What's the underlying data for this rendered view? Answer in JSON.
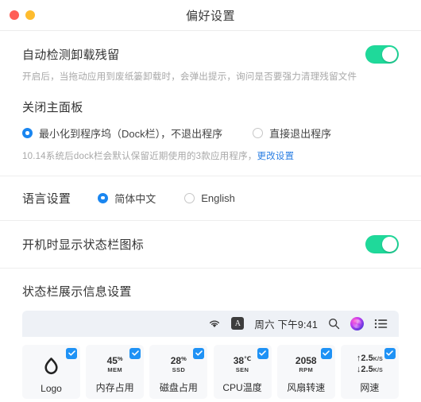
{
  "window": {
    "title": "偏好设置",
    "controls": [
      {
        "name": "close-button",
        "color": "#ff5f57"
      },
      {
        "name": "minimize-button",
        "color": "#febc2e"
      }
    ]
  },
  "sections": {
    "auto_detect": {
      "heading": "自动检测卸载残留",
      "description": "开启后，当拖动应用到废纸篓卸载时，会弹出提示，询问是否要强力清理残留文件",
      "toggle_on": true
    },
    "close_panel": {
      "heading": "关闭主面板",
      "options": [
        {
          "label": "最小化到程序坞（Dock栏），不退出程序",
          "selected": true
        },
        {
          "label": "直接退出程序",
          "selected": false
        }
      ],
      "note_text": "10.14系统后dock栏会默认保留近期使用的3款应用程序，",
      "note_link": "更改设置"
    },
    "language": {
      "heading": "语言设置",
      "options": [
        {
          "label": "简体中文",
          "selected": true
        },
        {
          "label": "English",
          "selected": false
        }
      ]
    },
    "startup_icon": {
      "heading": "开机时显示状态栏图标",
      "toggle_on": true
    },
    "statusbar_info": {
      "heading": "状态栏展示信息设置",
      "preview": {
        "icons": [
          "wifi-icon",
          "input-method-icon",
          "search-icon",
          "siri-icon",
          "control-center-icon"
        ],
        "input_method_label": "A",
        "time": "周六 下午9:41"
      },
      "cards": [
        {
          "id": "logo",
          "label": "Logo",
          "type": "logo",
          "checked": true
        },
        {
          "id": "memory",
          "label": "内存占用",
          "type": "metric",
          "value": "45",
          "unit": "%",
          "sub": "MEM",
          "checked": true
        },
        {
          "id": "disk",
          "label": "磁盘占用",
          "type": "metric",
          "value": "28",
          "unit": "%",
          "sub": "SSD",
          "checked": true
        },
        {
          "id": "cpu-temp",
          "label": "CPU温度",
          "type": "metric",
          "value": "38",
          "unit": "℃",
          "sub": "SEN",
          "checked": true
        },
        {
          "id": "fan-speed",
          "label": "风扇转速",
          "type": "metric",
          "value": "2058",
          "unit": "",
          "sub": "RPM",
          "checked": true
        },
        {
          "id": "network",
          "label": "网速",
          "type": "network",
          "upload": "2.5",
          "upload_unit": "K/S",
          "download": "2.5",
          "download_unit": "K/S",
          "checked": true
        }
      ]
    }
  },
  "colors": {
    "toggle_on": "#1fd99a",
    "radio_selected": "#1a86f0",
    "checkbox": "#1f92f5",
    "link": "#2b7fe3",
    "panel_bg": "#eef1f6",
    "card_bg": "#f7f8fa"
  }
}
